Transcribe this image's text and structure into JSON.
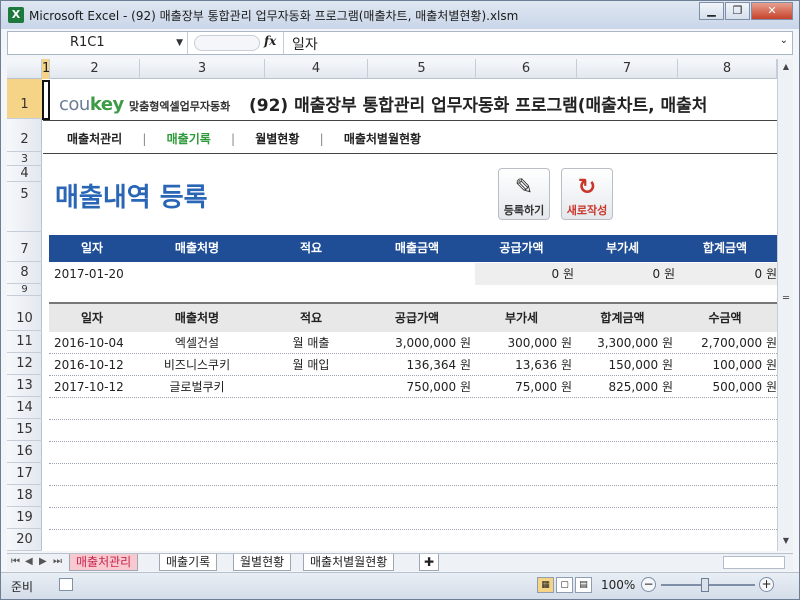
{
  "window": {
    "title": "Microsoft Excel - (92) 매출장부 통합관리 업무자동화 프로그램(매출차트, 매출처별현황).xlsm",
    "app_icon": "X"
  },
  "formula_bar": {
    "name_box": "R1C1",
    "fx_label": "fx",
    "value": "일자"
  },
  "columns": [
    "1",
    "2",
    "3",
    "4",
    "5",
    "6",
    "7",
    "8"
  ],
  "rows": [
    "1",
    "2",
    "3",
    "4",
    "5",
    "7",
    "8",
    "9",
    "10",
    "11",
    "12",
    "13",
    "14",
    "15",
    "16",
    "17",
    "18",
    "19",
    "20"
  ],
  "header": {
    "logo_main": "cou",
    "logo_accent": "key",
    "logo_sub": "맞춤형엑셀업무자동화",
    "app_title": "(92) 매출장부 통합관리 업무자동화 프로그램(매출차트, 매출처"
  },
  "nav": {
    "items": [
      "매출처관리",
      "매출기록",
      "월별현황",
      "매출처별월현황"
    ],
    "separator": "|",
    "active_color": "#2e9a3a"
  },
  "page": {
    "title": "매출내역 등록",
    "register_label": "등록하기",
    "new_label": "새로작성",
    "title_color": "#2a66b6"
  },
  "input_table": {
    "headers": [
      "일자",
      "매출처명",
      "적요",
      "매출금액",
      "공급가액",
      "부가세",
      "합계금액"
    ],
    "row": [
      "2017-01-20",
      "",
      "",
      "",
      "0 원",
      "0 원",
      "0 원"
    ],
    "header_color": "#1f4e96"
  },
  "list_table": {
    "headers": [
      "일자",
      "매출처명",
      "적요",
      "공급가액",
      "부가세",
      "합계금액",
      "수금액"
    ],
    "rows": [
      [
        "2016-10-04",
        "엑셀건설",
        "월 매출",
        "3,000,000 원",
        "300,000 원",
        "3,300,000 원",
        "2,700,000 원"
      ],
      [
        "2016-10-12",
        "비즈니스쿠키",
        "월 매입",
        "136,364 원",
        "13,636 원",
        "150,000 원",
        "100,000 원"
      ],
      [
        "2017-10-12",
        "글로벌쿠키",
        "",
        "750,000 원",
        "75,000 원",
        "825,000 원",
        "500,000 원"
      ]
    ]
  },
  "sheet_tabs": [
    "매출처관리",
    "매출기록",
    "월별현황",
    "매출처별월현황"
  ],
  "status": {
    "ready": "준비",
    "zoom": "100%"
  }
}
